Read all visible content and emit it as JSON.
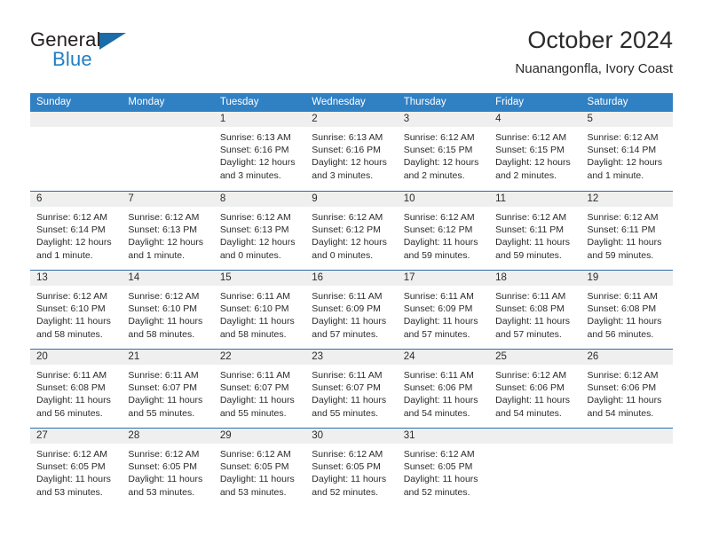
{
  "brand": {
    "line1": "General",
    "line2": "Blue",
    "triangle_color": "#1b6ca8",
    "blue_text_color": "#1f7ec4"
  },
  "header": {
    "title": "October 2024",
    "subtitle": "Nuanangonfla, Ivory Coast",
    "accent_color": "#3080c4"
  },
  "calendar": {
    "weekday_headers": [
      "Sunday",
      "Monday",
      "Tuesday",
      "Wednesday",
      "Thursday",
      "Friday",
      "Saturday"
    ],
    "weeks": [
      [
        {
          "day": "",
          "empty": true
        },
        {
          "day": "",
          "empty": true
        },
        {
          "day": "1",
          "sunrise": "Sunrise: 6:13 AM",
          "sunset": "Sunset: 6:16 PM",
          "daylight": "Daylight: 12 hours and 3 minutes."
        },
        {
          "day": "2",
          "sunrise": "Sunrise: 6:13 AM",
          "sunset": "Sunset: 6:16 PM",
          "daylight": "Daylight: 12 hours and 3 minutes."
        },
        {
          "day": "3",
          "sunrise": "Sunrise: 6:12 AM",
          "sunset": "Sunset: 6:15 PM",
          "daylight": "Daylight: 12 hours and 2 minutes."
        },
        {
          "day": "4",
          "sunrise": "Sunrise: 6:12 AM",
          "sunset": "Sunset: 6:15 PM",
          "daylight": "Daylight: 12 hours and 2 minutes."
        },
        {
          "day": "5",
          "sunrise": "Sunrise: 6:12 AM",
          "sunset": "Sunset: 6:14 PM",
          "daylight": "Daylight: 12 hours and 1 minute."
        }
      ],
      [
        {
          "day": "6",
          "sunrise": "Sunrise: 6:12 AM",
          "sunset": "Sunset: 6:14 PM",
          "daylight": "Daylight: 12 hours and 1 minute."
        },
        {
          "day": "7",
          "sunrise": "Sunrise: 6:12 AM",
          "sunset": "Sunset: 6:13 PM",
          "daylight": "Daylight: 12 hours and 1 minute."
        },
        {
          "day": "8",
          "sunrise": "Sunrise: 6:12 AM",
          "sunset": "Sunset: 6:13 PM",
          "daylight": "Daylight: 12 hours and 0 minutes."
        },
        {
          "day": "9",
          "sunrise": "Sunrise: 6:12 AM",
          "sunset": "Sunset: 6:12 PM",
          "daylight": "Daylight: 12 hours and 0 minutes."
        },
        {
          "day": "10",
          "sunrise": "Sunrise: 6:12 AM",
          "sunset": "Sunset: 6:12 PM",
          "daylight": "Daylight: 11 hours and 59 minutes."
        },
        {
          "day": "11",
          "sunrise": "Sunrise: 6:12 AM",
          "sunset": "Sunset: 6:11 PM",
          "daylight": "Daylight: 11 hours and 59 minutes."
        },
        {
          "day": "12",
          "sunrise": "Sunrise: 6:12 AM",
          "sunset": "Sunset: 6:11 PM",
          "daylight": "Daylight: 11 hours and 59 minutes."
        }
      ],
      [
        {
          "day": "13",
          "sunrise": "Sunrise: 6:12 AM",
          "sunset": "Sunset: 6:10 PM",
          "daylight": "Daylight: 11 hours and 58 minutes."
        },
        {
          "day": "14",
          "sunrise": "Sunrise: 6:12 AM",
          "sunset": "Sunset: 6:10 PM",
          "daylight": "Daylight: 11 hours and 58 minutes."
        },
        {
          "day": "15",
          "sunrise": "Sunrise: 6:11 AM",
          "sunset": "Sunset: 6:10 PM",
          "daylight": "Daylight: 11 hours and 58 minutes."
        },
        {
          "day": "16",
          "sunrise": "Sunrise: 6:11 AM",
          "sunset": "Sunset: 6:09 PM",
          "daylight": "Daylight: 11 hours and 57 minutes."
        },
        {
          "day": "17",
          "sunrise": "Sunrise: 6:11 AM",
          "sunset": "Sunset: 6:09 PM",
          "daylight": "Daylight: 11 hours and 57 minutes."
        },
        {
          "day": "18",
          "sunrise": "Sunrise: 6:11 AM",
          "sunset": "Sunset: 6:08 PM",
          "daylight": "Daylight: 11 hours and 57 minutes."
        },
        {
          "day": "19",
          "sunrise": "Sunrise: 6:11 AM",
          "sunset": "Sunset: 6:08 PM",
          "daylight": "Daylight: 11 hours and 56 minutes."
        }
      ],
      [
        {
          "day": "20",
          "sunrise": "Sunrise: 6:11 AM",
          "sunset": "Sunset: 6:08 PM",
          "daylight": "Daylight: 11 hours and 56 minutes."
        },
        {
          "day": "21",
          "sunrise": "Sunrise: 6:11 AM",
          "sunset": "Sunset: 6:07 PM",
          "daylight": "Daylight: 11 hours and 55 minutes."
        },
        {
          "day": "22",
          "sunrise": "Sunrise: 6:11 AM",
          "sunset": "Sunset: 6:07 PM",
          "daylight": "Daylight: 11 hours and 55 minutes."
        },
        {
          "day": "23",
          "sunrise": "Sunrise: 6:11 AM",
          "sunset": "Sunset: 6:07 PM",
          "daylight": "Daylight: 11 hours and 55 minutes."
        },
        {
          "day": "24",
          "sunrise": "Sunrise: 6:11 AM",
          "sunset": "Sunset: 6:06 PM",
          "daylight": "Daylight: 11 hours and 54 minutes."
        },
        {
          "day": "25",
          "sunrise": "Sunrise: 6:12 AM",
          "sunset": "Sunset: 6:06 PM",
          "daylight": "Daylight: 11 hours and 54 minutes."
        },
        {
          "day": "26",
          "sunrise": "Sunrise: 6:12 AM",
          "sunset": "Sunset: 6:06 PM",
          "daylight": "Daylight: 11 hours and 54 minutes."
        }
      ],
      [
        {
          "day": "27",
          "sunrise": "Sunrise: 6:12 AM",
          "sunset": "Sunset: 6:05 PM",
          "daylight": "Daylight: 11 hours and 53 minutes."
        },
        {
          "day": "28",
          "sunrise": "Sunrise: 6:12 AM",
          "sunset": "Sunset: 6:05 PM",
          "daylight": "Daylight: 11 hours and 53 minutes."
        },
        {
          "day": "29",
          "sunrise": "Sunrise: 6:12 AM",
          "sunset": "Sunset: 6:05 PM",
          "daylight": "Daylight: 11 hours and 53 minutes."
        },
        {
          "day": "30",
          "sunrise": "Sunrise: 6:12 AM",
          "sunset": "Sunset: 6:05 PM",
          "daylight": "Daylight: 11 hours and 52 minutes."
        },
        {
          "day": "31",
          "sunrise": "Sunrise: 6:12 AM",
          "sunset": "Sunset: 6:05 PM",
          "daylight": "Daylight: 11 hours and 52 minutes."
        },
        {
          "day": "",
          "empty": true
        },
        {
          "day": "",
          "empty": true
        }
      ]
    ]
  }
}
